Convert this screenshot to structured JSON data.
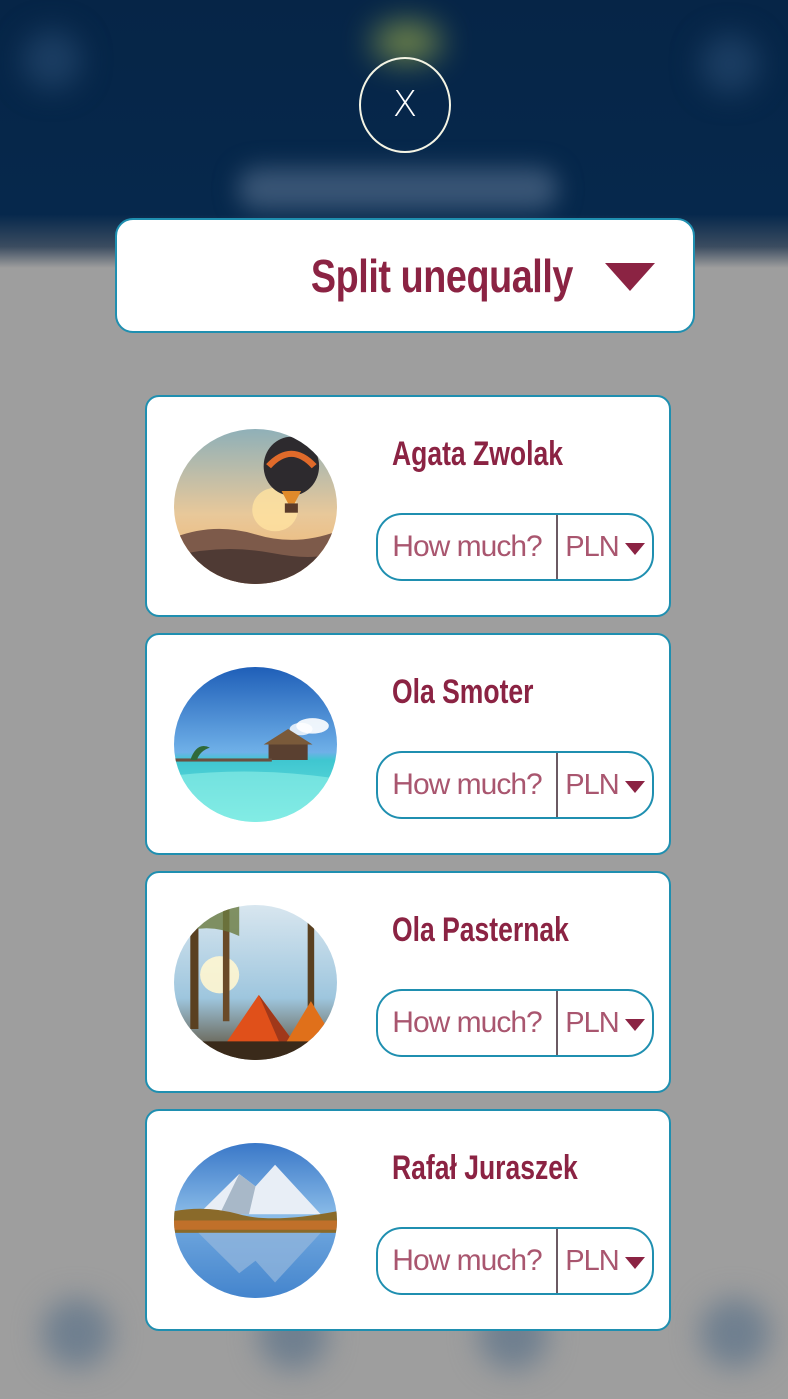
{
  "header": {
    "close_label": "X"
  },
  "split_selector": {
    "selected": "Split unequally"
  },
  "participants": [
    {
      "name": "Agata Zwolak",
      "amount_placeholder": "How much?",
      "currency": "PLN",
      "avatar": "hot-air-balloon-photo"
    },
    {
      "name": "Ola Smoter",
      "amount_placeholder": "How much?",
      "currency": "PLN",
      "avatar": "tropical-bungalow-photo"
    },
    {
      "name": "Ola Pasternak",
      "amount_placeholder": "How much?",
      "currency": "PLN",
      "avatar": "camping-tents-photo"
    },
    {
      "name": "Rafał Juraszek",
      "amount_placeholder": "How much?",
      "currency": "PLN",
      "avatar": "mountain-lake-photo"
    }
  ],
  "colors": {
    "accent": "#8b2343",
    "border": "#1f8fb0",
    "header_bg": "#062547",
    "overlay_bg": "#9e9e9e"
  }
}
